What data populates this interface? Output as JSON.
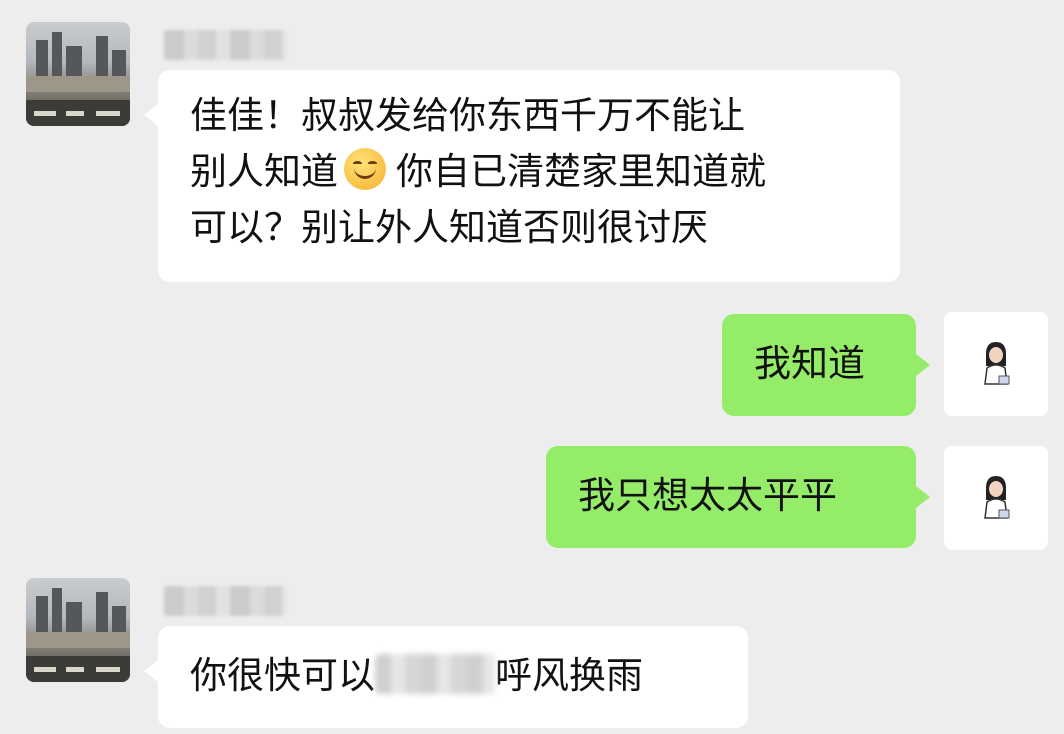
{
  "messages": [
    {
      "side": "incoming",
      "avatar": "city-skyline-avatar",
      "sender_name": "",
      "lines": [
        "佳佳！叔叔发给你东西千万不能让",
        "别人知道",
        "你自已清楚家里知道就",
        "可以？别让外人知道否则很讨厌"
      ],
      "emoji": "smiling-face-icon"
    },
    {
      "side": "outgoing",
      "avatar": "girl-avatar",
      "text": "我知道"
    },
    {
      "side": "outgoing",
      "avatar": "girl-avatar",
      "text": "我只想太太平平"
    },
    {
      "side": "incoming",
      "avatar": "city-skyline-avatar",
      "sender_name": "",
      "text_before": "你很快可以",
      "text_after": "呼风换雨"
    }
  ],
  "colors": {
    "background": "#ededed",
    "incoming_bubble": "#ffffff",
    "outgoing_bubble": "#95ec69"
  }
}
